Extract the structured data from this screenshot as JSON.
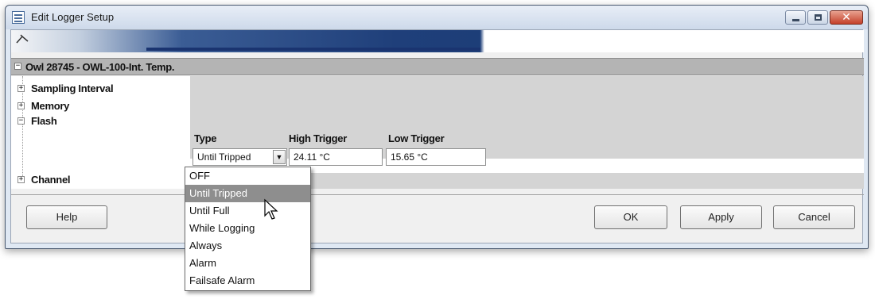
{
  "window": {
    "title": "Edit Logger Setup",
    "controls": [
      "minimize-icon",
      "maximize-icon",
      "close-icon"
    ]
  },
  "device": {
    "header": "Owl 28745 - OWL-100-Int. Temp."
  },
  "tree": {
    "items": [
      {
        "label": "Sampling Interval",
        "expander": "+"
      },
      {
        "label": "Memory",
        "expander": "+"
      },
      {
        "label": "Flash",
        "expander": "−"
      },
      {
        "label": "Channel",
        "expander": "+"
      }
    ]
  },
  "flash": {
    "columns": {
      "type": "Type",
      "high": "High Trigger",
      "low": "Low Trigger"
    },
    "type_value": "Until Tripped",
    "high_value": "24.11 °C",
    "low_value": "15.65 °C",
    "dropdown_options": [
      "OFF",
      "Until Tripped",
      "Until Full",
      "While Logging",
      "Always",
      "Alarm",
      "Failsafe Alarm"
    ],
    "highlighted_option": "Until Tripped"
  },
  "buttons": {
    "help": "Help",
    "ok": "OK",
    "apply": "Apply",
    "cancel": "Cancel"
  },
  "colors": {
    "banner": "#1f3f7a",
    "section_header": "#b4b4b4",
    "highlight": "#8e8e8e"
  }
}
